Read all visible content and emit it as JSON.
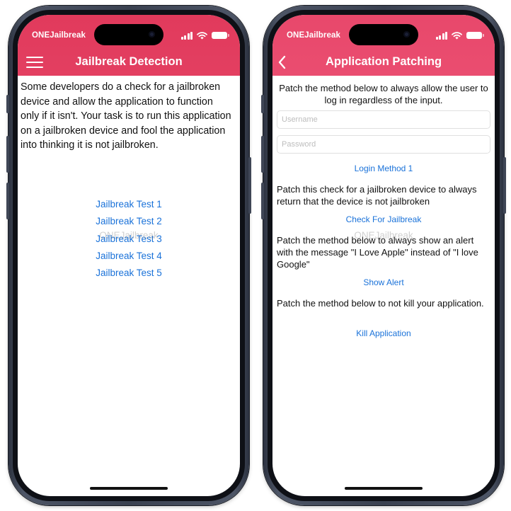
{
  "left_phone": {
    "carrier": "ONEJailbreak",
    "title": "Jailbreak Detection",
    "description": "Some developers do a check for a jailbroken device and allow the application to function only if it isn't. Your task is to run this application on a jailbroken device and fool the application into thinking it is not jailbroken.",
    "tests": [
      "Jailbreak Test 1",
      "Jailbreak Test 2",
      "Jailbreak Test 3",
      "Jailbreak Test 4",
      "Jailbreak Test 5"
    ],
    "watermark": "ONEJailbreak"
  },
  "right_phone": {
    "carrier": "ONEJailbreak",
    "title": "Application Patching",
    "login_desc": "Patch the method below to always allow the user to log in regardless of the input.",
    "username_placeholder": "Username",
    "password_placeholder": "Password",
    "login_button": "Login Method 1",
    "jailbreak_desc": "Patch this check for a jailbroken device to always return that the device is not jailbroken",
    "jailbreak_button": "Check For Jailbreak",
    "alert_desc": "Patch the method below to always show an alert with the message \"I Love Apple\" instead of \"I love Google\"",
    "alert_button": "Show Alert",
    "kill_desc": "Patch the method below to not kill your application.",
    "kill_button": "Kill Application",
    "watermark": "ONEJailbreak"
  },
  "colors": {
    "header_left": "#e13a5c",
    "header_right": "#ea4d70",
    "link": "#1a72d9",
    "frame": "#3a4150"
  }
}
